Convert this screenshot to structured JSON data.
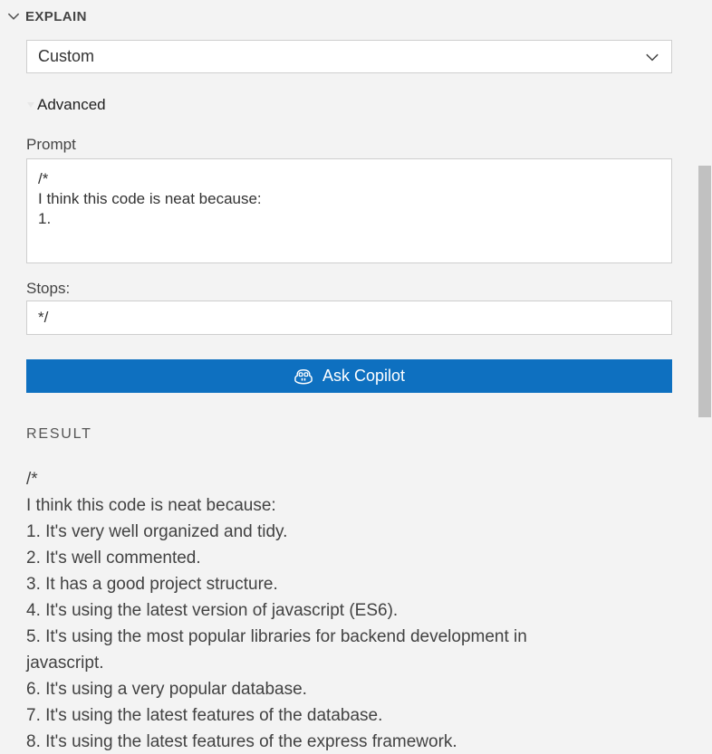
{
  "section": {
    "title": "EXPLAIN",
    "chevron_icon": "chevron-down-icon"
  },
  "mode_select": {
    "value": "Custom",
    "icon": "chevron-down-icon"
  },
  "advanced": {
    "label": "Advanced",
    "icon": "disclosure-triangle-icon"
  },
  "prompt": {
    "label": "Prompt",
    "value": "/*\nI think this code is neat because:\n1."
  },
  "stops": {
    "label": "Stops:",
    "value": "*/"
  },
  "ask_button": {
    "label": "Ask Copilot",
    "icon": "copilot-icon",
    "background": "#0e70c0"
  },
  "result": {
    "heading": "RESULT",
    "lines": [
      "/*",
      "I think this code is neat because:",
      "1. It's very well organized and tidy.",
      "2. It's well commented.",
      "3. It has a good project structure.",
      "4. It's using the latest version of javascript (ES6).",
      "5. It's using the most popular libraries for backend development in javascript.",
      "6. It's using a very popular database.",
      "7. It's using the latest features of the database.",
      "8. It's using the latest features of the express framework."
    ]
  }
}
